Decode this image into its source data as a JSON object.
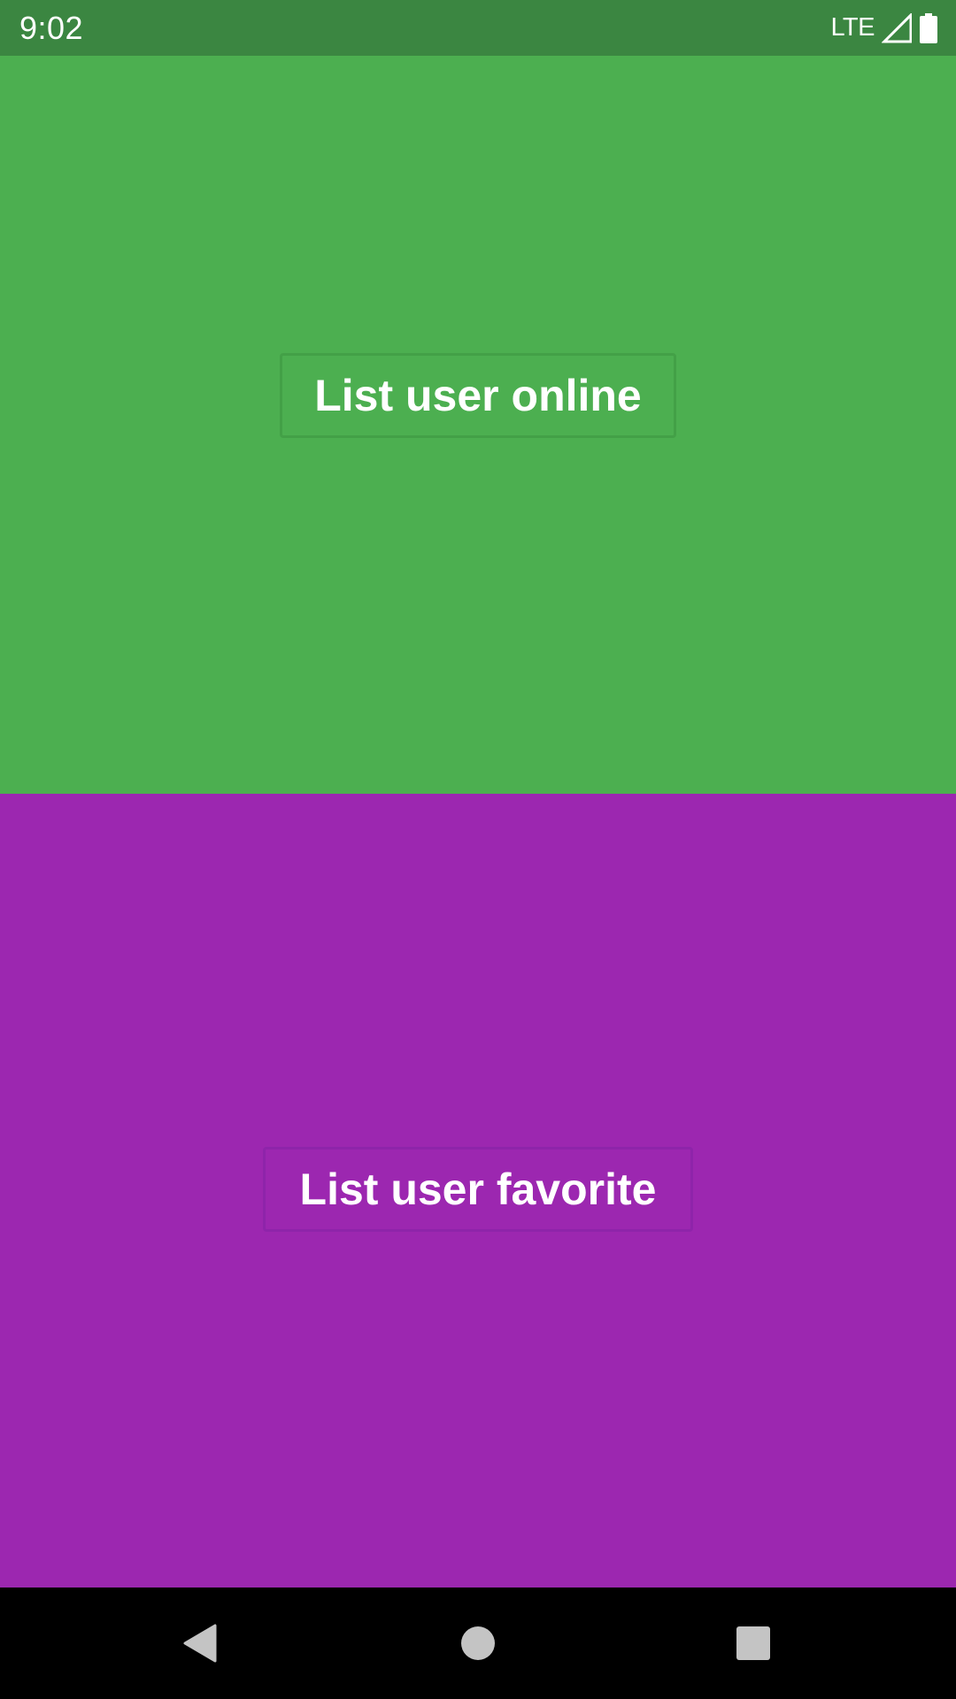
{
  "status_bar": {
    "time": "9:02",
    "network": "LTE",
    "signal_icon": "cell-signal-icon",
    "battery_icon": "battery-icon",
    "background": "#3b8641"
  },
  "panels": {
    "top": {
      "background": "#4caf50",
      "button_label": "List user online",
      "button_border": "#43a047"
    },
    "bottom": {
      "background": "#9c27b0",
      "button_label": "List user favorite",
      "button_border": "#8e24aa"
    }
  },
  "nav_bar": {
    "background": "#000000",
    "icon_color": "#c4c4c4",
    "back_icon": "back-triangle-icon",
    "home_icon": "home-circle-icon",
    "recents_icon": "recents-square-icon"
  }
}
